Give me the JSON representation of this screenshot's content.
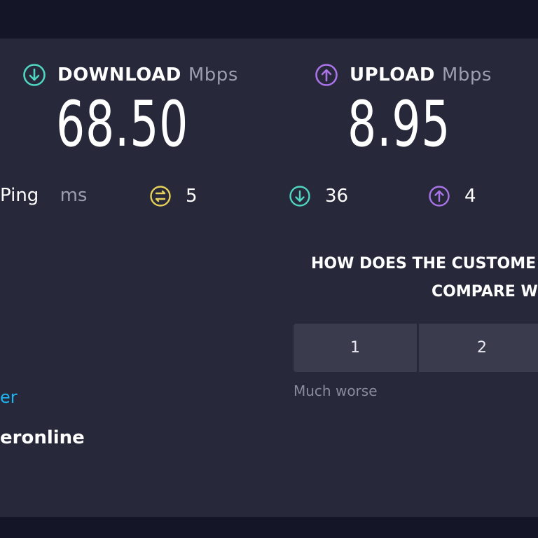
{
  "download": {
    "label": "DOWNLOAD",
    "unit": "Mbps",
    "value": "68.50",
    "color": "#4fd6c0"
  },
  "upload": {
    "label": "UPLOAD",
    "unit": "Mbps",
    "value": "8.95",
    "color": "#a974e8"
  },
  "ping": {
    "label": "Ping",
    "unit": "ms",
    "jitter": {
      "icon": "jitter-icon",
      "value": "5",
      "color": "#e6d15a"
    },
    "download": {
      "icon": "download-arrow-icon",
      "value": "36"
    },
    "upload": {
      "icon": "upload-arrow-icon",
      "value": "4"
    }
  },
  "survey": {
    "question_line1": "HOW DOES THE CUSTOME",
    "question_line2": "COMPARE W",
    "options": [
      "1",
      "2"
    ],
    "hint": "Much worse"
  },
  "server": {
    "link_fragment": "er",
    "isp_fragment": "eronline"
  }
}
